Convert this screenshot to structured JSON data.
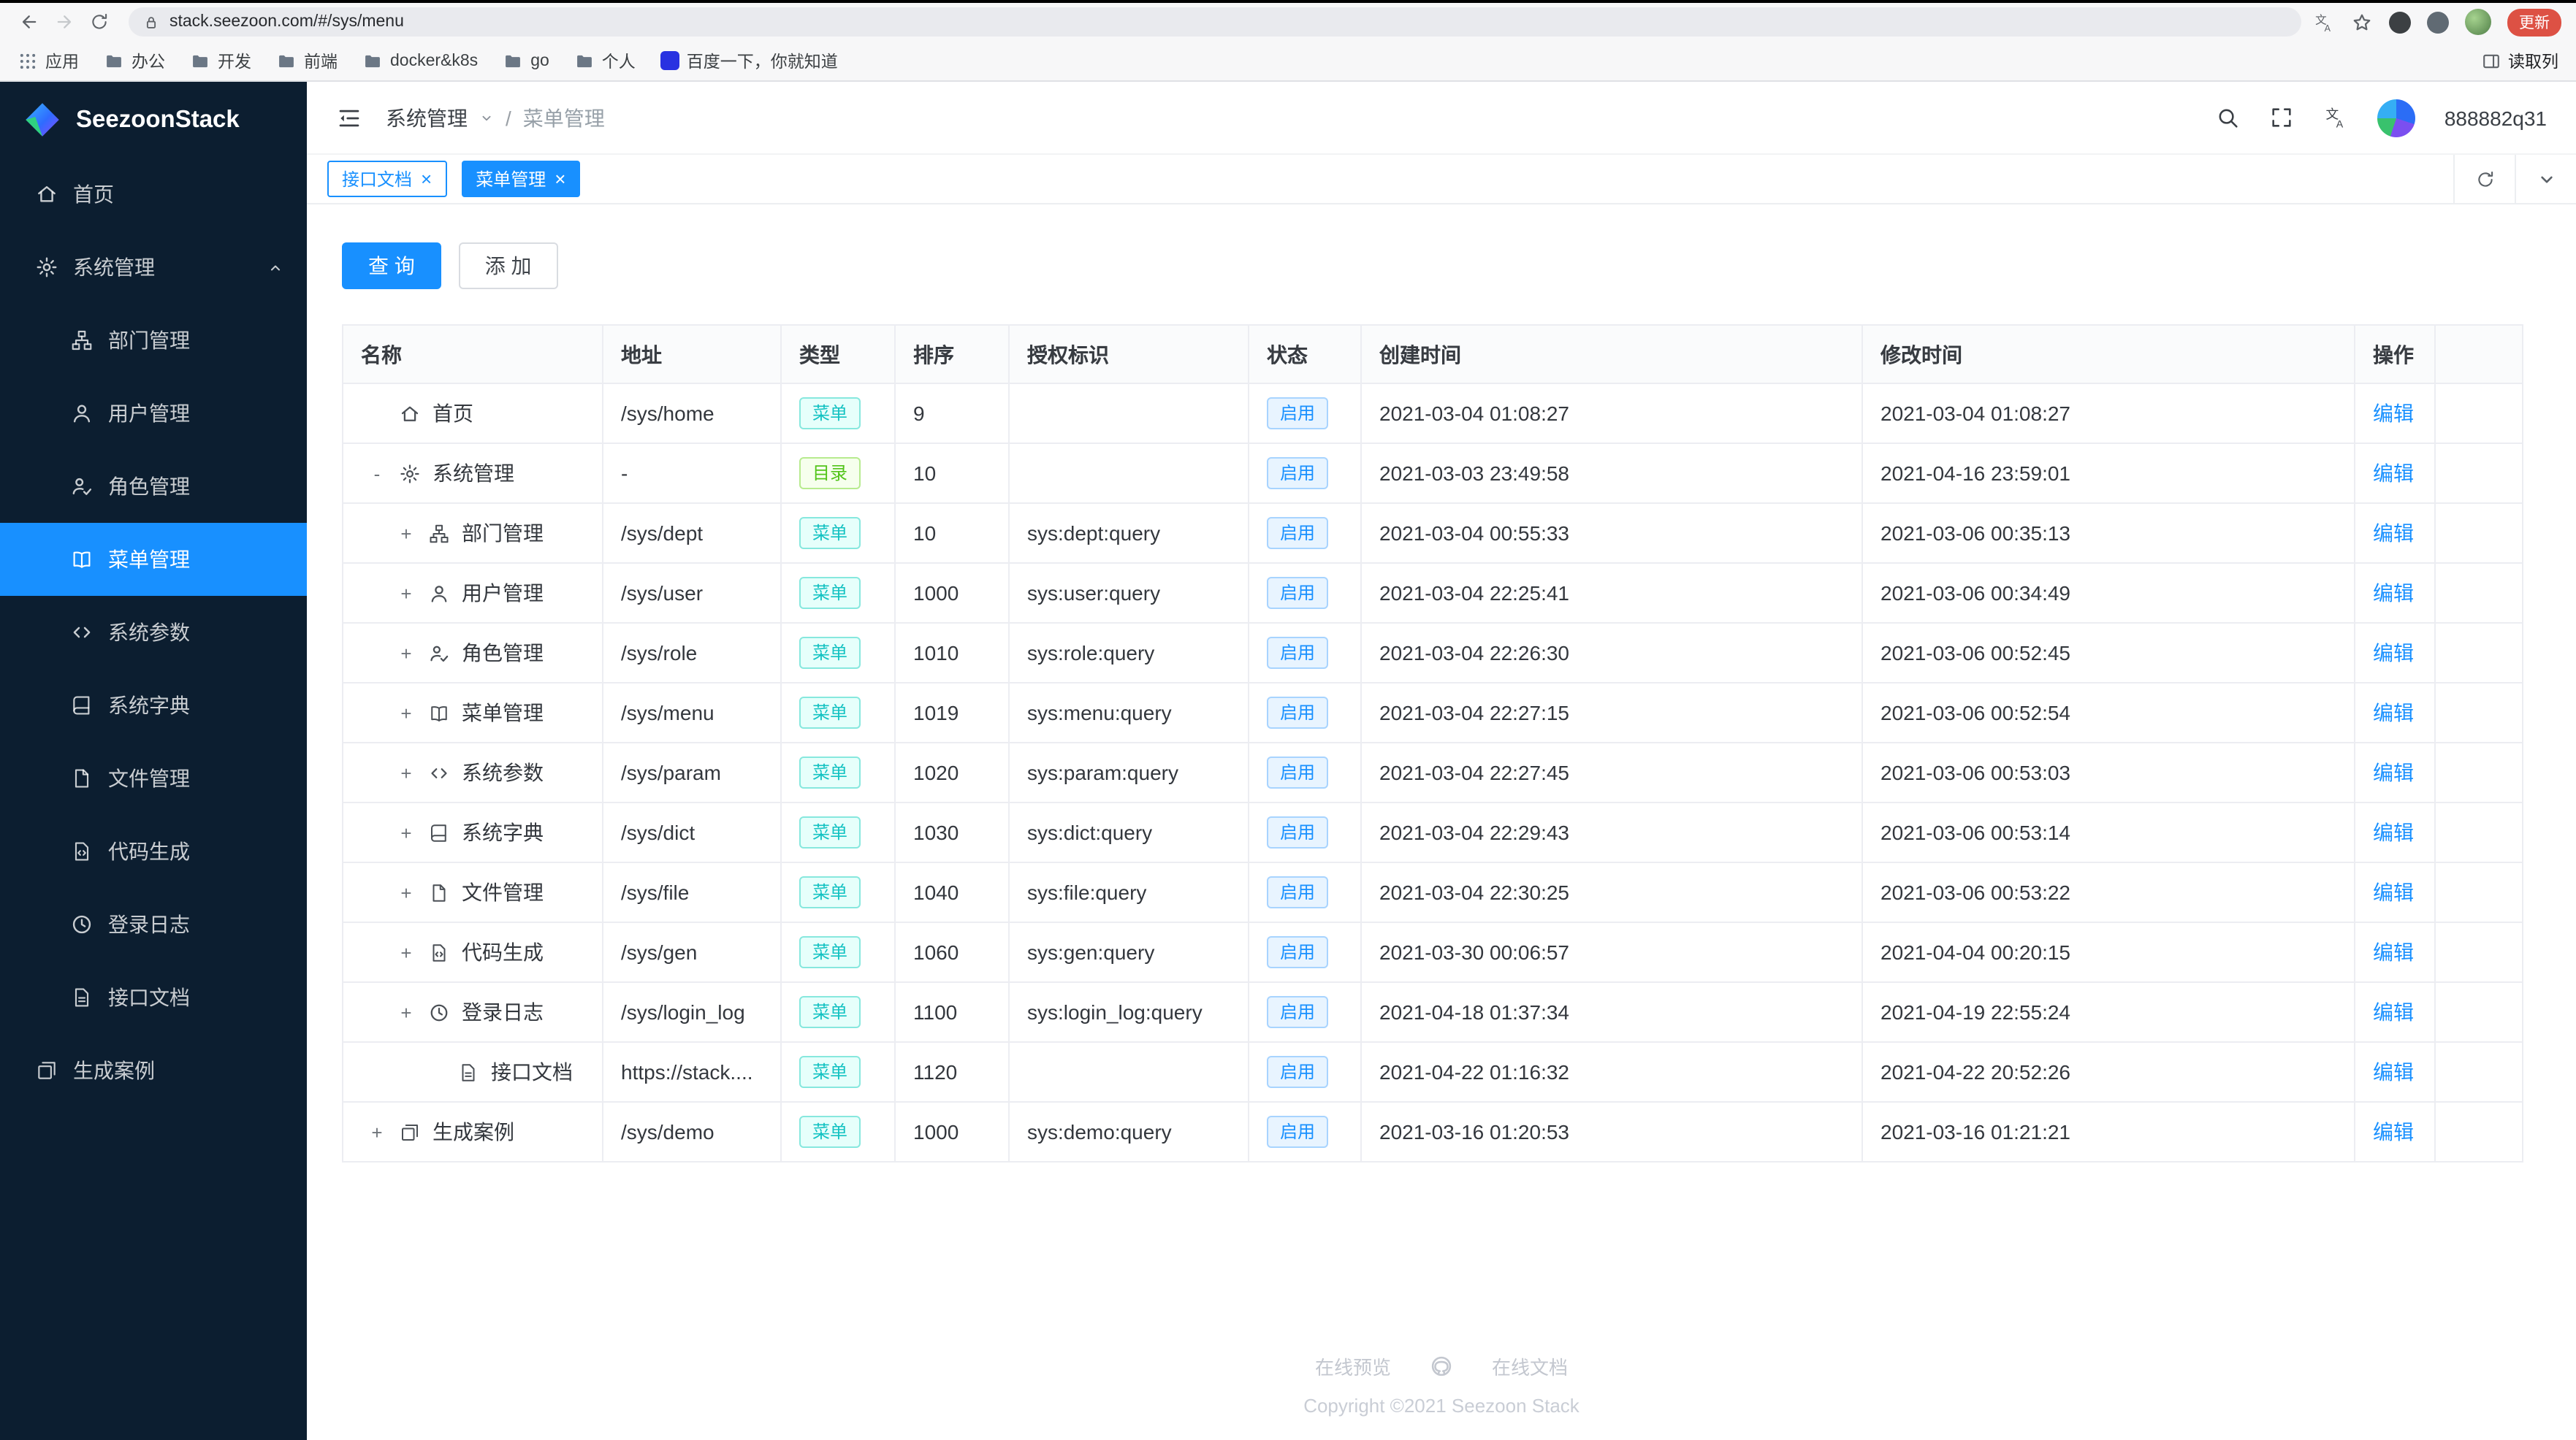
{
  "browser": {
    "url": "stack.seezoon.com/#/sys/menu",
    "update_label": "更新",
    "reading_list_label": "读取列",
    "bookmarks": [
      {
        "label": "应用",
        "icon": "apps"
      },
      {
        "label": "办公",
        "icon": "folder"
      },
      {
        "label": "开发",
        "icon": "folder"
      },
      {
        "label": "前端",
        "icon": "folder"
      },
      {
        "label": "docker&k8s",
        "icon": "folder"
      },
      {
        "label": "go",
        "icon": "folder"
      },
      {
        "label": "个人",
        "icon": "folder"
      },
      {
        "label": "百度一下，你就知道",
        "icon": "baidu"
      }
    ]
  },
  "sidebar": {
    "brand": "SeezoonStack",
    "items": [
      {
        "label": "首页",
        "icon": "home",
        "level": 0
      },
      {
        "label": "系统管理",
        "icon": "gear",
        "level": 0,
        "caret": "up"
      },
      {
        "label": "部门管理",
        "icon": "dept",
        "level": 1
      },
      {
        "label": "用户管理",
        "icon": "user",
        "level": 1
      },
      {
        "label": "角色管理",
        "icon": "role",
        "level": 1
      },
      {
        "label": "菜单管理",
        "icon": "menu",
        "level": 1,
        "active": true
      },
      {
        "label": "系统参数",
        "icon": "param",
        "level": 1
      },
      {
        "label": "系统字典",
        "icon": "dict",
        "level": 1
      },
      {
        "label": "文件管理",
        "icon": "file",
        "level": 1
      },
      {
        "label": "代码生成",
        "icon": "gen",
        "level": 1
      },
      {
        "label": "登录日志",
        "icon": "log",
        "level": 1
      },
      {
        "label": "接口文档",
        "icon": "doc",
        "level": 1
      },
      {
        "label": "生成案例",
        "icon": "demo",
        "level": 0
      }
    ]
  },
  "header": {
    "breadcrumb_parent": "系统管理",
    "breadcrumb_separator": "/",
    "breadcrumb_current": "菜单管理",
    "username": "888882q31"
  },
  "tabs": [
    {
      "label": "接口文档",
      "active": false
    },
    {
      "label": "菜单管理",
      "active": true
    }
  ],
  "toolbar": {
    "query_label": "查 询",
    "add_label": "添 加"
  },
  "table": {
    "columns": [
      "名称",
      "地址",
      "类型",
      "排序",
      "授权标识",
      "状态",
      "创建时间",
      "修改时间",
      "操作"
    ],
    "tag_colors": {
      "菜单": "cyan",
      "目录": "green"
    },
    "action_label": "编辑",
    "rows": [
      {
        "name": "首页",
        "icon": "home",
        "level": 0,
        "expander": "",
        "addr": "/sys/home",
        "type": "菜单",
        "sort": "9",
        "perm": "",
        "status": "启用",
        "created": "2021-03-04 01:08:27",
        "updated": "2021-03-04 01:08:27"
      },
      {
        "name": "系统管理",
        "icon": "gear",
        "level": 0,
        "expander": "-",
        "addr": "-",
        "type": "目录",
        "sort": "10",
        "perm": "",
        "status": "启用",
        "created": "2021-03-03 23:49:58",
        "updated": "2021-04-16 23:59:01"
      },
      {
        "name": "部门管理",
        "icon": "dept",
        "level": 1,
        "expander": "+",
        "addr": "/sys/dept",
        "type": "菜单",
        "sort": "10",
        "perm": "sys:dept:query",
        "status": "启用",
        "created": "2021-03-04 00:55:33",
        "updated": "2021-03-06 00:35:13"
      },
      {
        "name": "用户管理",
        "icon": "user",
        "level": 1,
        "expander": "+",
        "addr": "/sys/user",
        "type": "菜单",
        "sort": "1000",
        "perm": "sys:user:query",
        "status": "启用",
        "created": "2021-03-04 22:25:41",
        "updated": "2021-03-06 00:34:49"
      },
      {
        "name": "角色管理",
        "icon": "role",
        "level": 1,
        "expander": "+",
        "addr": "/sys/role",
        "type": "菜单",
        "sort": "1010",
        "perm": "sys:role:query",
        "status": "启用",
        "created": "2021-03-04 22:26:30",
        "updated": "2021-03-06 00:52:45"
      },
      {
        "name": "菜单管理",
        "icon": "menu",
        "level": 1,
        "expander": "+",
        "addr": "/sys/menu",
        "type": "菜单",
        "sort": "1019",
        "perm": "sys:menu:query",
        "status": "启用",
        "created": "2021-03-04 22:27:15",
        "updated": "2021-03-06 00:52:54"
      },
      {
        "name": "系统参数",
        "icon": "param",
        "level": 1,
        "expander": "+",
        "addr": "/sys/param",
        "type": "菜单",
        "sort": "1020",
        "perm": "sys:param:query",
        "status": "启用",
        "created": "2021-03-04 22:27:45",
        "updated": "2021-03-06 00:53:03"
      },
      {
        "name": "系统字典",
        "icon": "dict",
        "level": 1,
        "expander": "+",
        "addr": "/sys/dict",
        "type": "菜单",
        "sort": "1030",
        "perm": "sys:dict:query",
        "status": "启用",
        "created": "2021-03-04 22:29:43",
        "updated": "2021-03-06 00:53:14"
      },
      {
        "name": "文件管理",
        "icon": "file",
        "level": 1,
        "expander": "+",
        "addr": "/sys/file",
        "type": "菜单",
        "sort": "1040",
        "perm": "sys:file:query",
        "status": "启用",
        "created": "2021-03-04 22:30:25",
        "updated": "2021-03-06 00:53:22"
      },
      {
        "name": "代码生成",
        "icon": "gen",
        "level": 1,
        "expander": "+",
        "addr": "/sys/gen",
        "type": "菜单",
        "sort": "1060",
        "perm": "sys:gen:query",
        "status": "启用",
        "created": "2021-03-30 00:06:57",
        "updated": "2021-04-04 00:20:15"
      },
      {
        "name": "登录日志",
        "icon": "log",
        "level": 1,
        "expander": "+",
        "addr": "/sys/login_log",
        "type": "菜单",
        "sort": "1100",
        "perm": "sys:login_log:query",
        "status": "启用",
        "created": "2021-04-18 01:37:34",
        "updated": "2021-04-19 22:55:24"
      },
      {
        "name": "接口文档",
        "icon": "doc",
        "level": 2,
        "expander": "",
        "addr": "https://stack....",
        "type": "菜单",
        "sort": "1120",
        "perm": "",
        "status": "启用",
        "created": "2021-04-22 01:16:32",
        "updated": "2021-04-22 20:52:26"
      },
      {
        "name": "生成案例",
        "icon": "demo",
        "level": 0,
        "expander": "+",
        "addr": "/sys/demo",
        "type": "菜单",
        "sort": "1000",
        "perm": "sys:demo:query",
        "status": "启用",
        "created": "2021-03-16 01:20:53",
        "updated": "2021-03-16 01:21:21"
      }
    ]
  },
  "footer": {
    "preview": "在线预览",
    "docs": "在线文档",
    "copyright": "Copyright ©2021 Seezoon Stack"
  }
}
